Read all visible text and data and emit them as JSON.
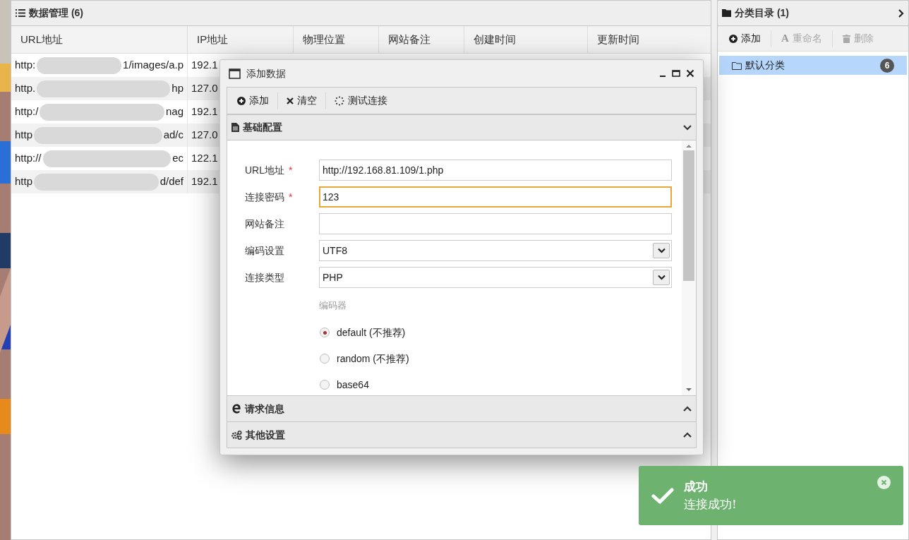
{
  "data_panel": {
    "title": "数据管理 (6)",
    "columns": [
      "URL地址",
      "IP地址",
      "物理位置",
      "网站备注",
      "创建时间",
      "更新时间"
    ],
    "rows": [
      {
        "url_start": "http:",
        "url_end": "1/images/a.p",
        "ip": "192.1"
      },
      {
        "url_start": "http.",
        "url_end": "hp",
        "ip": "127.0"
      },
      {
        "url_start": "http:/",
        "url_end": "nag",
        "ip": "192.1"
      },
      {
        "url_start": "http",
        "url_end": "ad/c",
        "ip": "127.0"
      },
      {
        "url_start": "http://",
        "url_end": "ec",
        "ip": "122.1"
      },
      {
        "url_start": "http",
        "url_end": "d/def",
        "ip": "192.1"
      }
    ]
  },
  "category_panel": {
    "title": "分类目录 (1)",
    "toolbar": [
      {
        "label": "添加",
        "disabled": false
      },
      {
        "icon_text": "A",
        "label": "重命名",
        "disabled": true
      },
      {
        "label": "删除",
        "disabled": true
      }
    ],
    "items": [
      {
        "label": "默认分类",
        "count": "6",
        "selected": true
      }
    ]
  },
  "dialog": {
    "title": "添加数据",
    "toolbar": [
      {
        "label": "添加"
      },
      {
        "label": "清空"
      },
      {
        "label": "测试连接"
      }
    ],
    "sections": [
      {
        "title": "基础配置",
        "expanded": true
      },
      {
        "title": "请求信息",
        "expanded": false
      },
      {
        "title": "其他设置",
        "expanded": false
      }
    ],
    "fields": [
      {
        "kind": "text",
        "label": "URL地址",
        "required_mark": "*",
        "value": "http://192.168.81.109/1.php",
        "focused": false
      },
      {
        "kind": "text",
        "label": "连接密码",
        "required_mark": "*",
        "value": "123",
        "focused": true
      },
      {
        "kind": "text",
        "label": "网站备注",
        "focused": false
      },
      {
        "kind": "select",
        "label": "编码设置",
        "value": "UTF8"
      },
      {
        "kind": "select",
        "label": "连接类型",
        "value": "PHP"
      }
    ],
    "encoder": {
      "label": "编码器",
      "options": [
        {
          "label": "default (不推荐)",
          "selected": true
        },
        {
          "label": "random (不推荐)",
          "selected": false
        },
        {
          "label": "base64",
          "selected": false
        }
      ]
    }
  },
  "toast": {
    "title": "成功",
    "message": "连接成功!"
  }
}
